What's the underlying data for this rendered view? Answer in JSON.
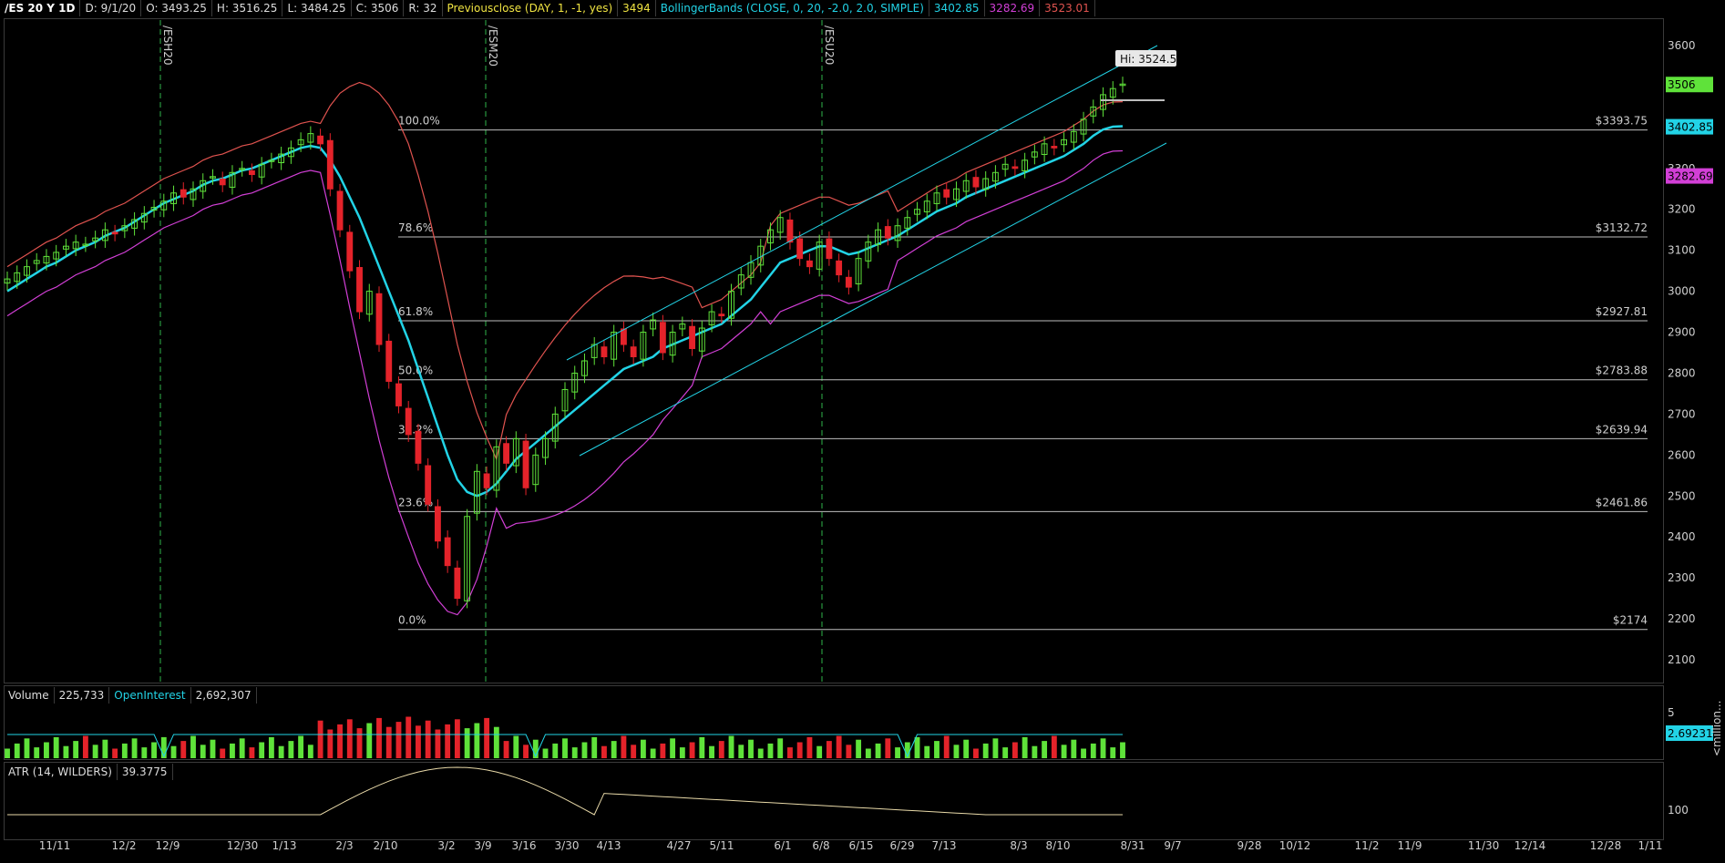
{
  "header": {
    "symbol": "/ES 20 Y 1D",
    "date": "D: 9/1/20",
    "open": "O: 3493.25",
    "high": "H: 3516.25",
    "low": "L: 3484.25",
    "close": "C: 3506",
    "range": "R: 32",
    "prevclose_label": "Previousclose (DAY, 1, -1, yes)",
    "prevclose_value": "3494",
    "bb_label": "BollingerBands (CLOSE, 0, 20, -2.0, 2.0, SIMPLE)",
    "bb_mid": "3402.85",
    "bb_low": "3282.69",
    "bb_up": "3523.01"
  },
  "colors": {
    "up": "#5fe23a",
    "down": "#e4232a",
    "mid": "#22d3e6",
    "upper_band": "#e0534f",
    "lower_band": "#d23fd6",
    "fib": "#bdbdbd",
    "prevclose": "#f0e442",
    "atr": "#e8d9a8",
    "oi": "#22d3e6"
  },
  "volume_header": {
    "label": "Volume",
    "value": "225,733",
    "oi_label": "OpenInterest",
    "oi_value": "2,692,307"
  },
  "atr_header": {
    "label": "ATR (14, WILDERS)",
    "value": "39.3775"
  },
  "hi_tooltip": "Hi: 3524.5",
  "contract_markers": [
    "/ESH20",
    "/ESM20",
    "/ESU20"
  ],
  "right_badges": {
    "close": "3506",
    "mid": "3402.85",
    "low": "3282.69"
  },
  "volume_axis": {
    "top": "5",
    "oi_badge": "2.69231",
    "unit": "<million..."
  },
  "atr_axis": {
    "tick": "100"
  },
  "chart_data": {
    "type": "candlestick",
    "title": "/ES 20 Y 1D",
    "price_axis": {
      "ticks": [
        2100,
        2200,
        2300,
        2400,
        2500,
        2600,
        2700,
        2800,
        2900,
        3000,
        3100,
        3200,
        3300,
        3400,
        3500,
        3600
      ],
      "range": [
        2050,
        3660
      ]
    },
    "x_ticks": [
      "11/11",
      "12/2",
      "12/9",
      "12/30",
      "1/13",
      "2/3",
      "2/10",
      "3/2",
      "3/9",
      "3/16",
      "3/30",
      "4/13",
      "4/27",
      "5/11",
      "6/1",
      "6/8",
      "6/15",
      "6/29",
      "7/13",
      "8/3",
      "8/10",
      "8/31",
      "9/7",
      "9/28",
      "10/12",
      "11/2",
      "11/9",
      "11/30",
      "12/14",
      "12/28",
      "1/11"
    ],
    "fib_levels": [
      {
        "pct": "100.0%",
        "price": "$3393.75",
        "value": 3393.75
      },
      {
        "pct": "78.6%",
        "price": "$3132.72",
        "value": 3132.72
      },
      {
        "pct": "61.8%",
        "price": "$2927.81",
        "value": 2927.81
      },
      {
        "pct": "50.0%",
        "price": "$2783.88",
        "value": 2783.88
      },
      {
        "pct": "38.2%",
        "price": "$2639.94",
        "value": 2639.94
      },
      {
        "pct": "23.6%",
        "price": "$2461.86",
        "value": 2461.86
      },
      {
        "pct": "0.0%",
        "price": "$2174",
        "value": 2174
      }
    ],
    "close_series": [
      3030,
      3045,
      3060,
      3075,
      3085,
      3095,
      3110,
      3120,
      3115,
      3130,
      3150,
      3140,
      3160,
      3175,
      3190,
      3205,
      3220,
      3240,
      3230,
      3250,
      3270,
      3280,
      3260,
      3290,
      3300,
      3285,
      3310,
      3320,
      3335,
      3350,
      3370,
      3385,
      3360,
      3250,
      3150,
      3050,
      2950,
      3000,
      2870,
      2780,
      2720,
      2650,
      2580,
      2480,
      2390,
      2330,
      2250,
      2450,
      2560,
      2520,
      2620,
      2580,
      2640,
      2520,
      2600,
      2640,
      2700,
      2760,
      2800,
      2830,
      2870,
      2840,
      2900,
      2870,
      2840,
      2900,
      2930,
      2850,
      2900,
      2920,
      2860,
      2910,
      2950,
      2940,
      3000,
      3040,
      3070,
      3110,
      3150,
      3180,
      3120,
      3080,
      3060,
      3120,
      3080,
      3040,
      3010,
      3080,
      3120,
      3150,
      3130,
      3160,
      3180,
      3200,
      3220,
      3240,
      3230,
      3250,
      3270,
      3255,
      3275,
      3290,
      3310,
      3300,
      3320,
      3340,
      3360,
      3350,
      3370,
      3390,
      3420,
      3450,
      3480,
      3495,
      3506
    ],
    "mid_series": [
      3000,
      3015,
      3030,
      3045,
      3060,
      3070,
      3085,
      3100,
      3110,
      3120,
      3135,
      3145,
      3155,
      3170,
      3185,
      3200,
      3215,
      3225,
      3235,
      3245,
      3260,
      3270,
      3275,
      3285,
      3295,
      3300,
      3310,
      3320,
      3330,
      3340,
      3350,
      3355,
      3350,
      3320,
      3280,
      3230,
      3180,
      3120,
      3060,
      3000,
      2940,
      2880,
      2810,
      2740,
      2670,
      2600,
      2540,
      2510,
      2500,
      2510,
      2530,
      2560,
      2590,
      2610,
      2630,
      2650,
      2670,
      2690,
      2710,
      2730,
      2750,
      2770,
      2790,
      2810,
      2820,
      2830,
      2840,
      2860,
      2870,
      2880,
      2890,
      2900,
      2910,
      2920,
      2940,
      2960,
      2980,
      3010,
      3040,
      3070,
      3080,
      3090,
      3100,
      3110,
      3110,
      3100,
      3090,
      3095,
      3105,
      3115,
      3125,
      3135,
      3150,
      3165,
      3180,
      3195,
      3205,
      3215,
      3230,
      3240,
      3250,
      3260,
      3270,
      3280,
      3290,
      3300,
      3310,
      3320,
      3330,
      3345,
      3360,
      3380,
      3395,
      3402,
      3403
    ],
    "series": [
      {
        "name": "BollingerBands upper",
        "values": []
      },
      {
        "name": "BollingerBands lower",
        "values": []
      }
    ],
    "hi": 3524.5
  }
}
